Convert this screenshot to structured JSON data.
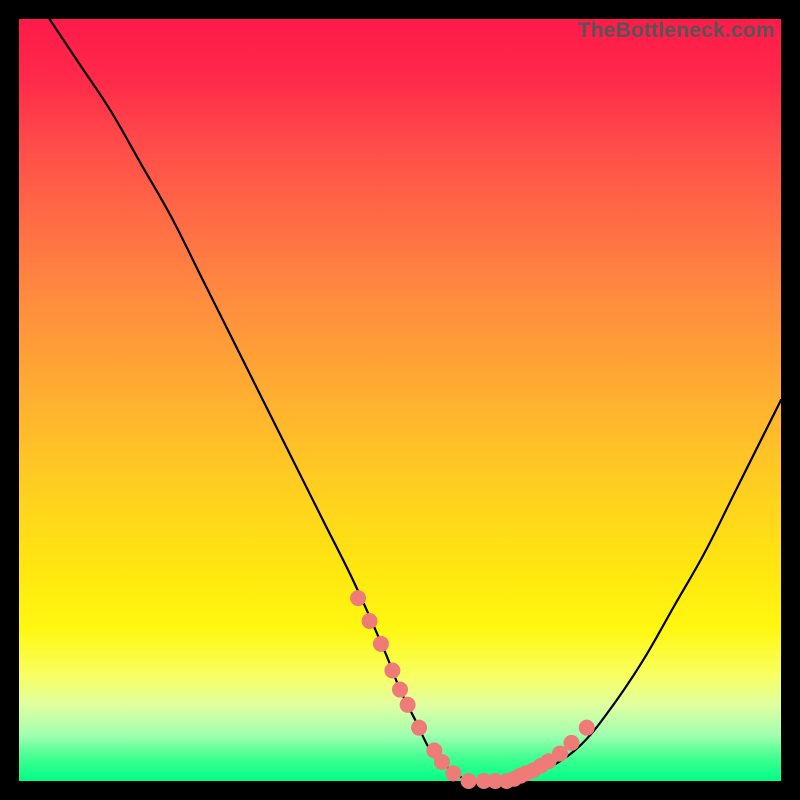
{
  "watermark": "TheBottleneck.com",
  "colors": {
    "frame": "#000000",
    "curve_stroke": "#000000",
    "marker_fill": "#ef7b78",
    "gradient_top": "#ff1a4a",
    "gradient_bottom": "#00ff88"
  },
  "chart_data": {
    "type": "line",
    "title": "",
    "xlabel": "",
    "ylabel": "",
    "xlim": [
      0,
      100
    ],
    "ylim": [
      0,
      100
    ],
    "grid": false,
    "series": [
      {
        "name": "bottleneck-curve",
        "x": [
          4,
          8,
          12,
          16,
          20,
          24,
          28,
          32,
          36,
          40,
          44,
          48,
          50,
          52,
          54,
          56,
          58,
          60,
          62,
          64,
          66,
          70,
          74,
          78,
          82,
          86,
          90,
          94,
          98,
          100
        ],
        "y": [
          100,
          94,
          88,
          81,
          74,
          66,
          58,
          50,
          42,
          34,
          26,
          17,
          12,
          8,
          4,
          2,
          0.5,
          0,
          0,
          0,
          0.5,
          2,
          5,
          10,
          16,
          23,
          30,
          38,
          46,
          50
        ]
      }
    ],
    "markers": {
      "name": "highlight-dots",
      "x": [
        44.5,
        46,
        47.5,
        49,
        50,
        51,
        52.5,
        54.5,
        55.5,
        57,
        59,
        61,
        62.5,
        64,
        65,
        65.8,
        66.5,
        67.5,
        68.5,
        69.5,
        71,
        72.5,
        74.5
      ],
      "y": [
        24,
        21,
        18,
        14.5,
        12,
        10,
        7,
        4,
        2.5,
        1,
        0,
        0,
        0,
        0,
        0.3,
        0.7,
        1,
        1.4,
        2,
        2.6,
        3.6,
        5,
        7
      ]
    }
  }
}
